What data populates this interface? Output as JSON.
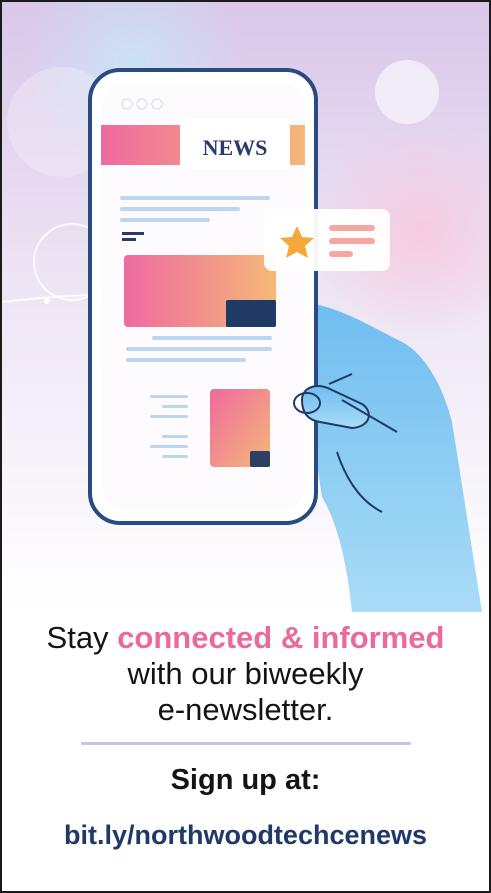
{
  "colors": {
    "accent_pink": "#ea6a9e",
    "navy": "#1f3a67",
    "divider": "#cbc1e2",
    "hand_blue": "#7fc7f0",
    "phone_frame": "#2a4a82"
  },
  "illustration": {
    "masthead": "NEWS",
    "icons": [
      "phone-illustration",
      "hand-illustration",
      "star-icon"
    ]
  },
  "message": {
    "lead": "Stay ",
    "highlight": "connected & informed",
    "line2": "with our biweekly",
    "line3": "e-newsletter."
  },
  "cta": {
    "signup": "Sign up at:",
    "url": "bit.ly/northwoodtechcenews"
  }
}
